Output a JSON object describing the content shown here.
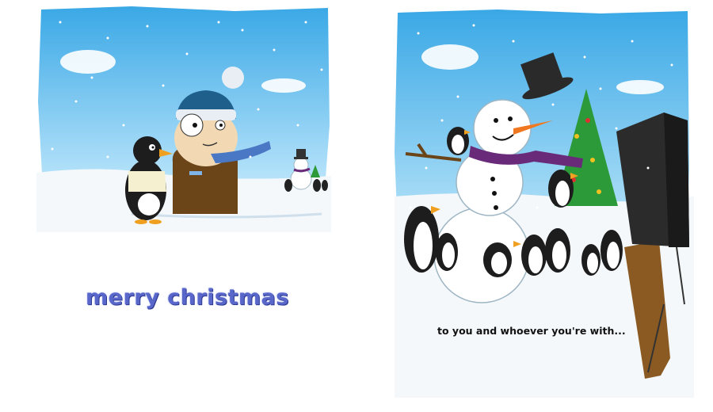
{
  "greeting": "merry christmas",
  "tagline": "to you and whoever you're with...",
  "colors": {
    "sky": "#4cb6ee",
    "greeting_text": "#5867c9",
    "hat": "#1f5f8c",
    "scarf_left": "#4a78c4",
    "scarf_snowman": "#6a2a7a",
    "carrot": "#f07820",
    "tree": "#2d9a3a",
    "shirt": "#f4f0d0",
    "jacket": "#6b4418"
  },
  "icons": [
    "penguin-icon",
    "snowman-icon",
    "top-hat-icon",
    "christmas-tree-icon",
    "speaker-icon",
    "cloud-icon",
    "snowflake-icon"
  ]
}
